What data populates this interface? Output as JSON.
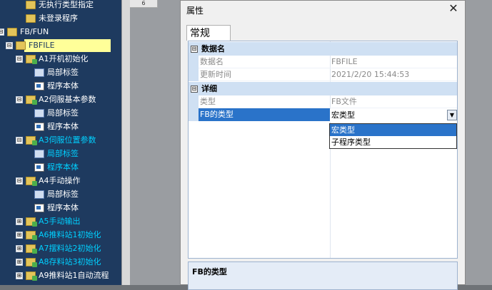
{
  "tree": {
    "items": [
      {
        "label": "无执行类型指定",
        "icon": "folder-icon",
        "cyan": false
      },
      {
        "label": "未登录程序",
        "icon": "folder-icon",
        "cyan": false
      },
      {
        "label": "FB/FUN",
        "icon": "folder-icon",
        "cyan": false,
        "exp": "⊟"
      },
      {
        "label": "FBFILE",
        "icon": "folder-icon",
        "cyan": false,
        "exp": "⊟",
        "selected": true
      },
      {
        "label": "A1开机初始化",
        "icon": "folder-icon",
        "cyan": false,
        "exp": "⊟"
      },
      {
        "label": "局部标签",
        "icon": "local-label-icon",
        "cyan": false
      },
      {
        "label": "程序本体",
        "icon": "program-body-icon",
        "cyan": false
      },
      {
        "label": "A2伺服基本参数",
        "icon": "folder-icon",
        "cyan": false,
        "exp": "⊟"
      },
      {
        "label": "局部标签",
        "icon": "local-label-icon",
        "cyan": false
      },
      {
        "label": "程序本体",
        "icon": "program-body-icon",
        "cyan": false
      },
      {
        "label": "A3伺服位置参数",
        "icon": "folder-icon",
        "cyan": true,
        "exp": "⊟"
      },
      {
        "label": "局部标签",
        "icon": "local-label-icon",
        "cyan": true
      },
      {
        "label": "程序本体",
        "icon": "program-body-icon",
        "cyan": true
      },
      {
        "label": "A4手动操作",
        "icon": "folder-icon",
        "cyan": false,
        "exp": "⊟"
      },
      {
        "label": "局部标签",
        "icon": "local-label-icon",
        "cyan": false
      },
      {
        "label": "程序本体",
        "icon": "program-body-icon",
        "cyan": false
      },
      {
        "label": "A5手动输出",
        "icon": "folder-icon",
        "cyan": true,
        "exp": "⊞"
      },
      {
        "label": "A6推料站1初始化",
        "icon": "folder-icon",
        "cyan": true,
        "exp": "⊞"
      },
      {
        "label": "A7摆料站2初始化",
        "icon": "folder-icon",
        "cyan": true,
        "exp": "⊞"
      },
      {
        "label": "A8存料站3初始化",
        "icon": "folder-icon",
        "cyan": true,
        "exp": "⊞"
      },
      {
        "label": "A9推料站1自动流程",
        "icon": "folder-icon",
        "cyan": false,
        "exp": "⊞"
      }
    ]
  },
  "grid_header": {
    "col": "6"
  },
  "dialog": {
    "title": "属性",
    "close": "✕",
    "tab": "常规",
    "sections": [
      {
        "label": "数据名",
        "collapse": "⊟",
        "rows": [
          {
            "name": "数据名",
            "value": "FBFILE"
          },
          {
            "name": "更新时间",
            "value": "2021/2/20 15:44:53"
          }
        ]
      },
      {
        "label": "详细",
        "collapse": "⊟",
        "rows": [
          {
            "name": "类型",
            "value": "FB文件"
          },
          {
            "name": "FB的类型",
            "value": "宏类型",
            "active": true
          }
        ]
      }
    ],
    "dropdown": {
      "options": [
        "宏类型",
        "子程序类型"
      ],
      "highlighted": 0,
      "arrow": "▼"
    },
    "description_title": "FB的类型"
  },
  "colors": {
    "tree_bg": "#1e3a5f",
    "selection": "#ffff99",
    "accent": "#2a73c9",
    "cyan_text": "#00d0ff"
  }
}
